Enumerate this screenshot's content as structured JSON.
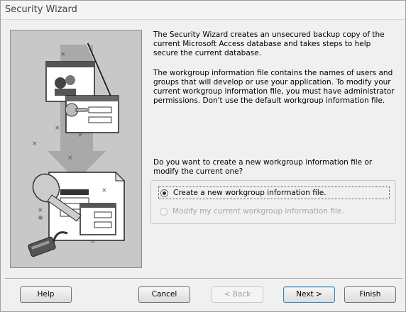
{
  "window": {
    "title": "Security Wizard"
  },
  "content": {
    "intro": "The Security Wizard creates an unsecured backup copy of the current Microsoft Access database and takes steps to help secure the current database.",
    "workgroup_info": "The workgroup information file contains the names of users and groups that will develop or use your application. To modify your current workgroup information file, you must have administrator permissions. Don't use the default workgroup information file.",
    "question": "Do you want to create a new workgroup information file or modify the current one?"
  },
  "options": {
    "create_new": {
      "label": "Create a new workgroup information file.",
      "selected": true
    },
    "modify_current": {
      "label": "Modify my current workgroup information file.",
      "enabled": false
    }
  },
  "buttons": {
    "help": "Help",
    "cancel": "Cancel",
    "back": "< Back",
    "next": "Next >",
    "finish": "Finish"
  },
  "illustration": {
    "icon": "security-wizard-illustration"
  }
}
